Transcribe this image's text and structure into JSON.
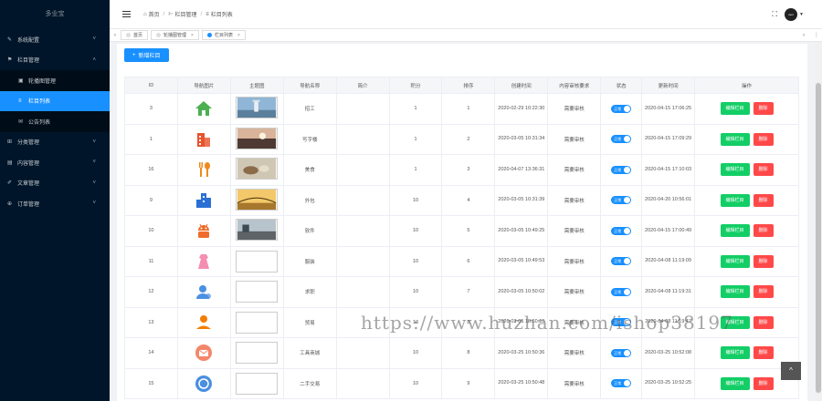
{
  "sidebar": {
    "brand": "多业宝",
    "menus": [
      {
        "label": "系统配置",
        "icon": "wrench-icon"
      },
      {
        "label": "栏目管理",
        "icon": "flag-icon",
        "expanded": true,
        "children": [
          {
            "label": "轮播图管理",
            "icon": "image-icon"
          },
          {
            "label": "栏目列表",
            "icon": "list-icon",
            "active": true
          },
          {
            "label": "公告列表",
            "icon": "megaphone-icon"
          }
        ]
      },
      {
        "label": "分类管理",
        "icon": "grid-icon"
      },
      {
        "label": "内容管理",
        "icon": "document-icon"
      },
      {
        "label": "文章管理",
        "icon": "edit-icon"
      },
      {
        "label": "订单管理",
        "icon": "cart-icon"
      }
    ]
  },
  "header": {
    "breadcrumb": [
      "首页",
      "栏目管理",
      "栏目列表"
    ],
    "avatar_text": "user"
  },
  "tabs": [
    {
      "label": "首页",
      "closable": false,
      "active": false
    },
    {
      "label": "轮播图管理",
      "closable": true,
      "active": false
    },
    {
      "label": "栏目列表",
      "closable": true,
      "active": true
    }
  ],
  "toolbar": {
    "add_label": "新增栏目"
  },
  "table": {
    "columns": [
      "ID",
      "导航图片",
      "主题图",
      "导航名称",
      "简介",
      "积分",
      "排序",
      "创建时间",
      "内容审核要求",
      "状态",
      "更新时间",
      "操作"
    ],
    "edit_label": "编辑栏目",
    "delete_label": "删除",
    "switch_label": "正常",
    "rows": [
      {
        "id": "3",
        "icon": "house-icon",
        "icon_color": "#4caf50",
        "theme": "tower",
        "name": "招工",
        "intro": "",
        "points": "1",
        "sort": "1",
        "created": "2020-02-29 10:22:30",
        "audit": "需要审核",
        "updated": "2020-04-15 17:06:25"
      },
      {
        "id": "1",
        "icon": "building-icon",
        "icon_color": "#e8532c",
        "theme": "sunset",
        "name": "写字楼",
        "intro": "",
        "points": "1",
        "sort": "2",
        "created": "2020-03-05 10:31:34",
        "audit": "需要审核",
        "updated": "2020-04-15 17:09:29"
      },
      {
        "id": "16",
        "icon": "fork-spoon-icon",
        "icon_color": "#f08a1c",
        "theme": "food",
        "name": "美食",
        "intro": "",
        "points": "1",
        "sort": "3",
        "created": "2020-04-07 13:36:31",
        "audit": "需要审核",
        "updated": "2020-04-15 17:10:03"
      },
      {
        "id": "9",
        "icon": "city-icon",
        "icon_color": "#2a6fd6",
        "theme": "bridge",
        "name": "外包",
        "intro": "",
        "points": "10",
        "sort": "4",
        "created": "2020-03-05 10:31:39",
        "audit": "需要审核",
        "updated": "2020-04-20 10:56:01"
      },
      {
        "id": "10",
        "icon": "android-icon",
        "icon_color": "#ef6c2a",
        "theme": "road",
        "name": "软件",
        "intro": "",
        "points": "10",
        "sort": "5",
        "created": "2020-03-05 10:49:25",
        "audit": "需要审核",
        "updated": "2020-04-15 17:00:49"
      },
      {
        "id": "11",
        "icon": "dress-icon",
        "icon_color": "#f48fb1",
        "theme": "",
        "name": "服装",
        "intro": "",
        "points": "10",
        "sort": "6",
        "created": "2020-03-05 10:49:53",
        "audit": "需要审核",
        "updated": "2020-04-08 11:19:09"
      },
      {
        "id": "12",
        "icon": "user-icon",
        "icon_color": "#4a90e2",
        "theme": "",
        "name": "求职",
        "intro": "",
        "points": "10",
        "sort": "7",
        "created": "2020-03-05 10:50:02",
        "audit": "需要审核",
        "updated": "2020-04-08 11:19:31"
      },
      {
        "id": "13",
        "icon": "person-hand-icon",
        "icon_color": "#f57c00",
        "theme": "",
        "name": "贸易",
        "intro": "",
        "points": "10",
        "sort": "8",
        "created": "2020-03-05 10:50:10",
        "audit": "需要审核",
        "updated": "2020-04-08 11:19:47"
      },
      {
        "id": "14",
        "icon": "mail-icon",
        "icon_color": "#f4866a",
        "theme": "",
        "name": "工具商城",
        "intro": "",
        "points": "10",
        "sort": "8",
        "created": "2020-03-25 10:50:36",
        "audit": "需要审核",
        "updated": "2020-03-25 10:52:08"
      },
      {
        "id": "15",
        "icon": "exchange-icon",
        "icon_color": "#4a8fe0",
        "theme": "",
        "name": "二手交易",
        "intro": "",
        "points": "10",
        "sort": "9",
        "created": "2020-03-25 10:50:48",
        "audit": "需要审核",
        "updated": "2020-03-25 10:52:25"
      }
    ]
  },
  "watermark": "https://www.huzhan.com/ishop38197"
}
